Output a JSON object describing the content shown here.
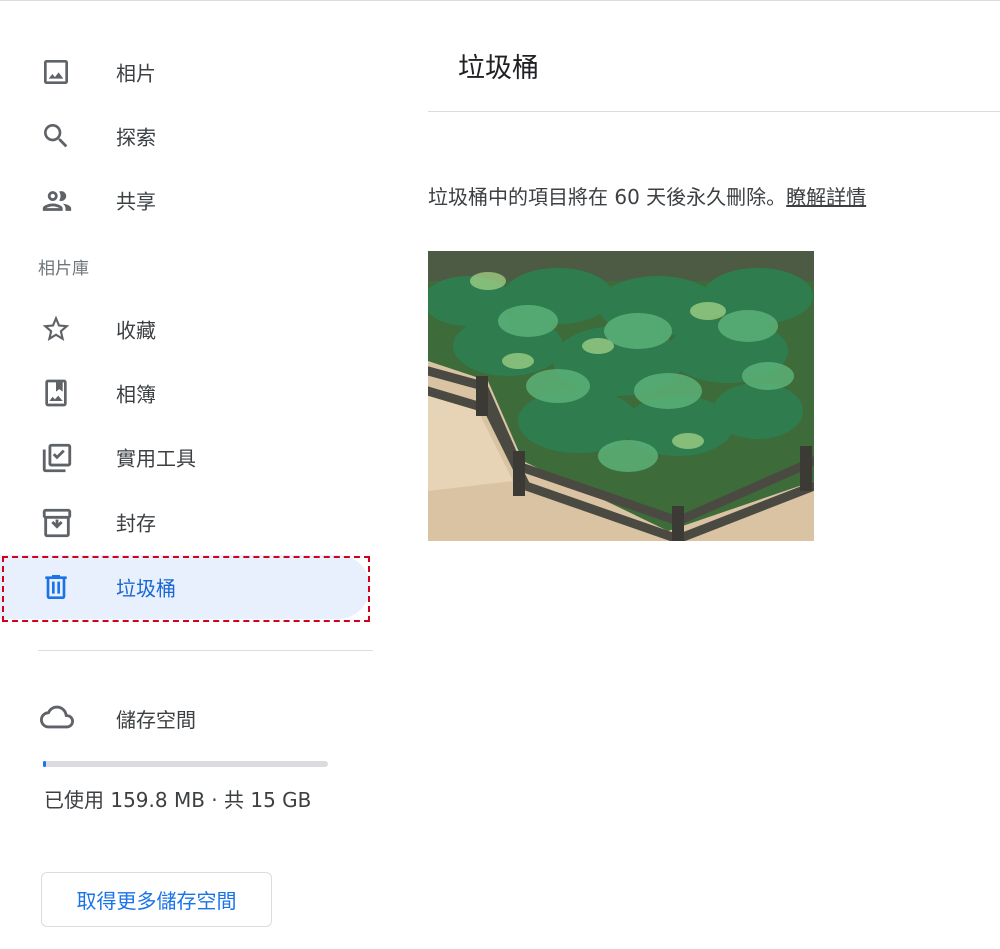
{
  "sidebar": {
    "items": [
      {
        "label": "相片",
        "icon": "photo-icon"
      },
      {
        "label": "探索",
        "icon": "search-icon"
      },
      {
        "label": "共享",
        "icon": "people-icon"
      }
    ],
    "library_header": "相片庫",
    "library_items": [
      {
        "label": "收藏",
        "icon": "star-icon"
      },
      {
        "label": "相簿",
        "icon": "album-icon"
      },
      {
        "label": "實用工具",
        "icon": "utilities-icon"
      },
      {
        "label": "封存",
        "icon": "archive-icon"
      },
      {
        "label": "垃圾桶",
        "icon": "trash-icon",
        "active": true
      }
    ],
    "storage": {
      "label": "儲存空間",
      "icon": "cloud-icon",
      "usage_text": "已使用 159.8 MB · 共 15 GB",
      "usage_fraction": 0.0104,
      "button_label": "取得更多儲存空間"
    }
  },
  "main": {
    "title": "垃圾桶",
    "info_text": "垃圾桶中的項目將在 60 天後永久刪除。",
    "info_link": "瞭解詳情"
  },
  "colors": {
    "accent": "#1a73e8",
    "active_bg": "#e8f0fe",
    "active_text": "#1967d2",
    "highlight": "#d0021b"
  }
}
